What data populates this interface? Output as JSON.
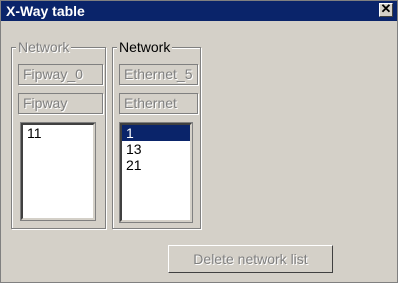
{
  "window": {
    "title": "X-Way table",
    "close_glyph": "✕"
  },
  "group_left": {
    "legend": "Network",
    "field_name": "Fipway_0",
    "field_type": "Fipway",
    "list_items": [
      "11"
    ]
  },
  "group_right": {
    "legend": "Network",
    "field_name": "Ethernet_5",
    "field_type": "Ethernet",
    "list_items": [
      "1",
      "13",
      "21"
    ],
    "selected_index": 0
  },
  "footer": {
    "delete_label": "Delete network list"
  },
  "colors": {
    "titlebar": "#0a246a",
    "selection": "#0a246a",
    "face": "#d4d0c8"
  },
  "icons": [
    "close-icon"
  ]
}
